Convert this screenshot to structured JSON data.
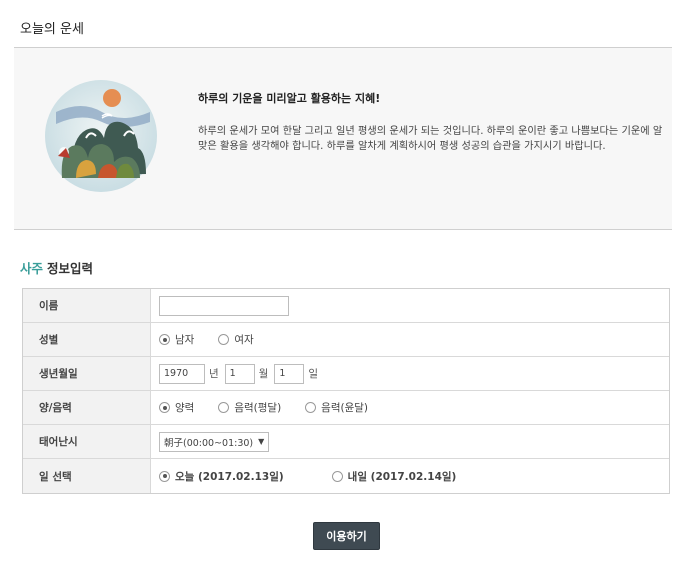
{
  "page": {
    "title": "오늘의 운세"
  },
  "intro": {
    "heading": "하루의 기운을 미리알고 활용하는 지혜!",
    "text": "하루의 운세가 모여 한달 그리고 일년 평생의 운세가 되는 것입니다. 하루의 운이란 좋고 나쁨보다는 기운에 알맞은 활용을 생각해야 합니다. 하루를 알차게 계획하시어 평생 성공의 습관을 가지시기 바랍니다."
  },
  "section": {
    "title_accent": "사주",
    "title_rest": "정보입력"
  },
  "form": {
    "name": {
      "label": "이름",
      "value": ""
    },
    "gender": {
      "label": "성별",
      "options": [
        "남자",
        "여자"
      ],
      "selected": "남자"
    },
    "birthdate": {
      "label": "생년월일",
      "year": "1970",
      "year_unit": "년",
      "month": "1",
      "month_unit": "월",
      "day": "1",
      "day_unit": "일"
    },
    "calendar": {
      "label": "양/음력",
      "options": [
        "양력",
        "음력(평달)",
        "음력(윤달)"
      ],
      "selected": "양력"
    },
    "birth_time": {
      "label": "태어난시",
      "value": "朝子(00:00~01:30)"
    },
    "date_select": {
      "label": "일 선택",
      "options": [
        "오늘 (2017.02.13일)",
        "내일 (2017.02.14일)"
      ],
      "selected": "오늘 (2017.02.13일)"
    }
  },
  "submit_label": "이용하기"
}
